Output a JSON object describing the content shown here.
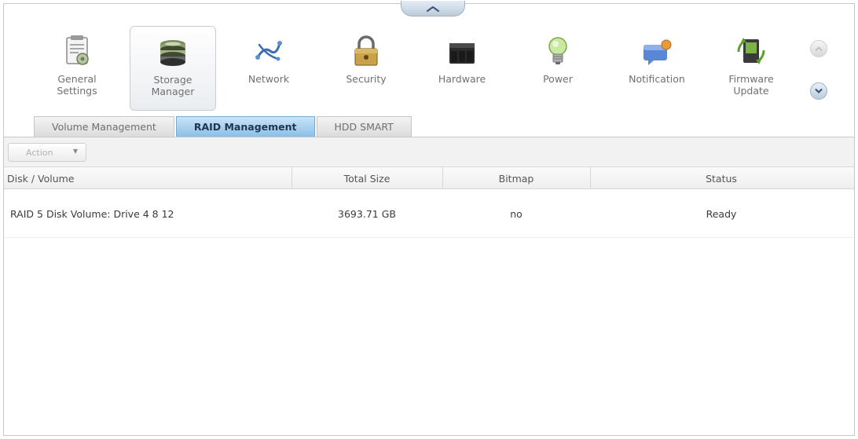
{
  "toolbar": {
    "items": [
      {
        "id": "general-settings",
        "label": "General\nSettings",
        "icon": "general-settings-icon"
      },
      {
        "id": "storage-manager",
        "label": "Storage\nManager",
        "icon": "storage-manager-icon",
        "active": true
      },
      {
        "id": "network",
        "label": "Network",
        "icon": "network-icon"
      },
      {
        "id": "security",
        "label": "Security",
        "icon": "padlock-icon"
      },
      {
        "id": "hardware",
        "label": "Hardware",
        "icon": "hardware-icon"
      },
      {
        "id": "power",
        "label": "Power",
        "icon": "lightbulb-icon"
      },
      {
        "id": "notification",
        "label": "Notification",
        "icon": "notification-icon"
      },
      {
        "id": "firmware-update",
        "label": "Firmware\nUpdate",
        "icon": "firmware-update-icon"
      }
    ],
    "scroll_up_icon": "chevron-up-icon",
    "scroll_down_icon": "chevron-down-icon",
    "collapse_icon": "chevron-up-icon"
  },
  "tabs": [
    {
      "label": "Volume Management",
      "active": false
    },
    {
      "label": "RAID Management",
      "active": true
    },
    {
      "label": "HDD SMART",
      "active": false
    }
  ],
  "action_bar": {
    "action_label": "Action"
  },
  "grid": {
    "columns": [
      "Disk / Volume",
      "Total Size",
      "Bitmap",
      "Status"
    ],
    "rows": [
      {
        "disk_volume": "RAID 5 Disk Volume: Drive 4 8 12",
        "total_size": "3693.71 GB",
        "bitmap": "no",
        "status": "Ready"
      }
    ]
  },
  "colors": {
    "active_tab": "#8bbfe6",
    "scroll_down": "#b9cbdc",
    "window_border": "#c4c8cc"
  }
}
